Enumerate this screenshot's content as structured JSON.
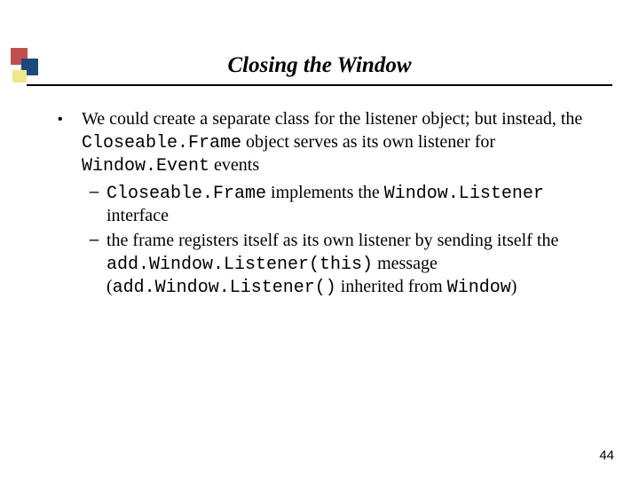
{
  "title": "Closing the Window",
  "bullet": {
    "part1": "We could create a separate class for the listener object; but instead, the ",
    "code1": "Closeable.Frame",
    "part2": " object serves as its own listener for ",
    "code2": "Window.Event",
    "part3": " events"
  },
  "sub1": {
    "code1": "Closeable.Frame",
    "part1": " implements the ",
    "code2": "Window.Listener",
    "part2": " interface"
  },
  "sub2": {
    "part1": "the frame registers itself as its own listener by sending itself the ",
    "code1": "add.Window.Listener(this)",
    "part2": " message (",
    "code2": "add.Window.Listener()",
    "part3": " inherited from ",
    "code3": "Window",
    "part4": ")"
  },
  "page_number": "44"
}
